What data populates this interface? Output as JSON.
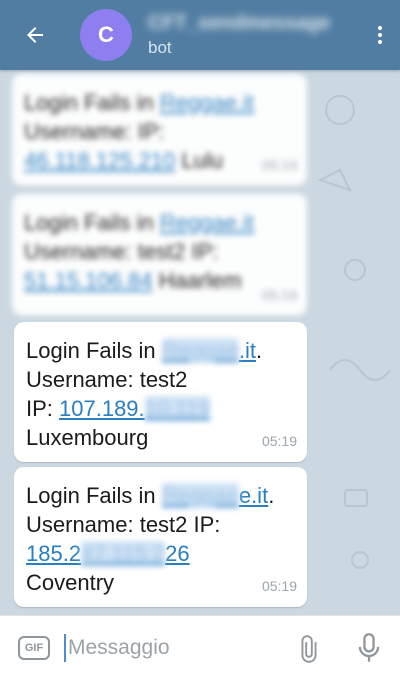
{
  "header": {
    "avatar_letter": "C",
    "chat_name": "CFT_sendmessage",
    "status": "bot"
  },
  "messages": [
    {
      "blurred": true,
      "line1_prefix": "Login Fails in ",
      "line1_link": "Reggae.it",
      "line2": "Username:  IP:",
      "line3_link": "46.118.125.210",
      "line3_suffix": " Lulu",
      "time": "05:19"
    },
    {
      "blurred": true,
      "line1_prefix": "Login Fails in ",
      "line1_link": "Reggae.it",
      "line2": "Username: test2 IP:",
      "line3_link": "51.15.106.84",
      "line3_suffix": " Haarlem",
      "time": "05:19"
    },
    {
      "blurred": false,
      "line1_prefix": "Login Fails in ",
      "line1_link_hidden": "Reggae",
      "line1_link_visible": ".it",
      "line1_suffix": ".",
      "line2": "Username: test2",
      "line3_prefix": "IP: ",
      "line3_link_visible": "107.189.",
      "line3_link_hidden": "10.119",
      "line4": "Luxembourg",
      "time": "05:19"
    },
    {
      "blurred": false,
      "line1_prefix": "Login Fails in ",
      "line1_link_hidden": "Reggae",
      "line1_link_visible": "e.it",
      "line1_suffix": ".",
      "line2": "Username: test2 IP:",
      "line3_link_start": "185.2",
      "line3_link_hidden": "47.115.2",
      "line3_link_end": "26",
      "line4": "Coventry",
      "time": "05:19"
    }
  ],
  "input": {
    "gif_label": "GIF",
    "placeholder": "Messaggio"
  },
  "icons": {
    "back": "arrow-left-icon",
    "menu": "dots-vertical-icon",
    "attach": "paperclip-icon",
    "mic": "microphone-icon"
  }
}
